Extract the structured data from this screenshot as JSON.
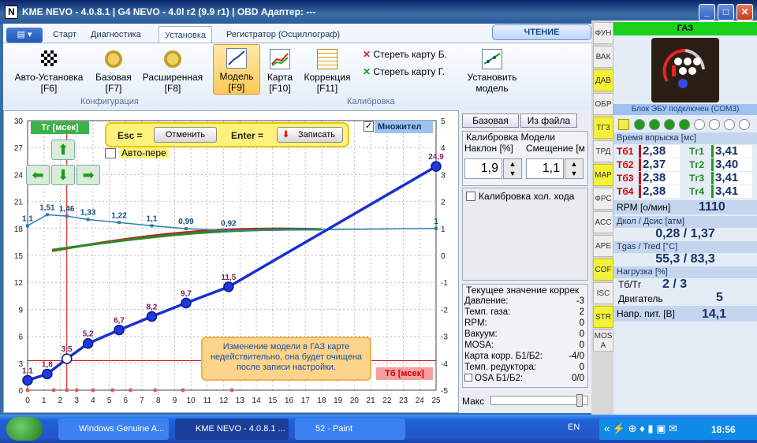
{
  "window": {
    "title": "KME NEVO - 4.0.8.1   |  G4 NEVO - 4.0l r2 (9.9 r1)  |  OBD Адаптер: ---",
    "icon": "N"
  },
  "tabs": [
    "Старт",
    "Диагностика",
    "Установка",
    "Регистратор (Осциллограф)"
  ],
  "read_button": "ЧТЕНИЕ",
  "ribbon": {
    "auto": [
      "Авто-Установка",
      "[F6]"
    ],
    "base": [
      "Базовая",
      "[F7]"
    ],
    "ext": [
      "Расширенная",
      "[F8]"
    ],
    "model": [
      "Модель",
      "[F9]"
    ],
    "map": [
      "Карта",
      "[F10]"
    ],
    "corr": [
      "Коррекция",
      "[F11]"
    ],
    "erase_b": "Стереть карту Б.",
    "erase_g": "Стереть карту Г.",
    "set_model": [
      "Установить",
      "модель"
    ],
    "group_config": "Конфигурация",
    "group_calib": "Калибровка"
  },
  "chart": {
    "tg_label": "Тг [мсек]",
    "tb_label": "Тб [мсек]",
    "esc": "Esc =",
    "cancel": "Отменить",
    "enter": "Enter =",
    "save": "Записать",
    "auto_check": "Авто-пере",
    "multiplier": "Множител",
    "notice": "Изменение модели в ГАЗ карте недействительно, она будет очищена после записи настройки.",
    "ylim": [
      0,
      30
    ],
    "yticks": [
      0,
      3,
      6,
      9,
      12,
      15,
      18,
      21,
      24,
      27,
      30
    ],
    "xlim": [
      0,
      25
    ],
    "xticks": [
      0,
      1,
      2,
      3,
      4,
      5,
      6,
      7,
      8,
      9,
      10,
      11,
      12,
      13,
      14,
      15,
      16,
      17,
      18,
      19,
      20,
      21,
      22,
      23,
      24,
      25
    ],
    "y2ticks": [
      5,
      4,
      3,
      2,
      1,
      0,
      -1,
      -2,
      -3,
      -4,
      -5
    ],
    "model_points": [
      {
        "x": 0,
        "y": 1.1
      },
      {
        "x": 1.2,
        "y": 1.8
      },
      {
        "x": 2.4,
        "y": 3.5
      },
      {
        "x": 3.7,
        "y": 5.2
      },
      {
        "x": 5.6,
        "y": 6.7
      },
      {
        "x": 7.6,
        "y": 8.2
      },
      {
        "x": 9.7,
        "y": 9.7
      },
      {
        "x": 12.3,
        "y": 11.5
      },
      {
        "x": 25,
        "y": 24.9
      }
    ],
    "model_labels": [
      "1,1",
      "1,8",
      "3,5",
      "5,2",
      "6,7",
      "8,2",
      "9,7",
      "11,5",
      "24,9"
    ],
    "mult_points": [
      {
        "x": 0,
        "y": 1.1
      },
      {
        "x": 1.2,
        "y": 1.51
      },
      {
        "x": 2.4,
        "y": 1.46
      },
      {
        "x": 3.7,
        "y": 1.33
      },
      {
        "x": 5.6,
        "y": 1.22
      },
      {
        "x": 7.6,
        "y": 1.1
      },
      {
        "x": 9.7,
        "y": 0.99
      },
      {
        "x": 12.3,
        "y": 0.92
      },
      {
        "x": 25,
        "y": 1
      }
    ],
    "mult_labels": [
      "1,1",
      "1,51",
      "1,46",
      "1,33",
      "1,22",
      "1,1",
      "0,99",
      "0,92",
      "1"
    ],
    "cursor_x": 2.4,
    "threshold_y": 3.3
  },
  "side": {
    "base": "Базовая",
    "fromfile": "Из файла",
    "calib_title": "Калибровка Модели",
    "slope_label": "Наклон [%]",
    "offset_label": "Смещение [м",
    "slope": "1,9",
    "offset": "1,1",
    "idle": "Калибровка хол. хода",
    "current_title": "Текущее значение коррек",
    "rows": [
      [
        "Давление:",
        "-3"
      ],
      [
        "Темп. газа:",
        "2"
      ],
      [
        "RPM:",
        "0"
      ],
      [
        "Вакуум:",
        "0"
      ],
      [
        "MOSA:",
        "0"
      ],
      [
        "Карта корр. Б1/Б2:",
        "-4/0"
      ],
      [
        "Темп. редуктора:",
        "0"
      ],
      [
        "OSA Б1/Б2:",
        "0/0"
      ]
    ],
    "max": "Макс"
  },
  "strip": [
    "ФУН",
    "ВАК",
    "ДАВ",
    "ОБР",
    "ТГЗ",
    "ТРД",
    "МАР",
    "ФРС",
    "АСС",
    "АРЕ",
    "COF",
    "ISC",
    "STR",
    "MOS A"
  ],
  "right": {
    "gas": "ГАЗ",
    "ecu": "Блок ЭБУ подключен (COM3)",
    "inj_title": "Время впрыска [мс]",
    "inj": [
      [
        "Тб1",
        "2,38",
        "Тг1",
        "3,41"
      ],
      [
        "Тб2",
        "2,37",
        "Тг2",
        "3,40"
      ],
      [
        "Тб3",
        "2,38",
        "Тг3",
        "3,41"
      ],
      [
        "Тб4",
        "2,38",
        "Тг4",
        "3,41"
      ]
    ],
    "rpm_label": "RPM [о/мин]",
    "rpm": "1110",
    "press_title": "Дкол / Дсис [атм]",
    "press": "0,28  /  1,37",
    "temp_title": "Tgas / Tred [°C]",
    "temp": "55,3  /  83,3",
    "load_title": "Нагрузка [%]",
    "load_label": "Тб/Тг",
    "load_val": "2   /   3",
    "engine_label": "Двигатель",
    "engine_val": "5",
    "volt_label": "Напр. пит. [В]",
    "volt": "14,1"
  },
  "taskbar": {
    "items": [
      "Windows Genuine A...",
      "KME NEVO - 4.0.8.1 ...",
      "52 - Paint"
    ],
    "lang": "EN",
    "time": "18:56"
  }
}
